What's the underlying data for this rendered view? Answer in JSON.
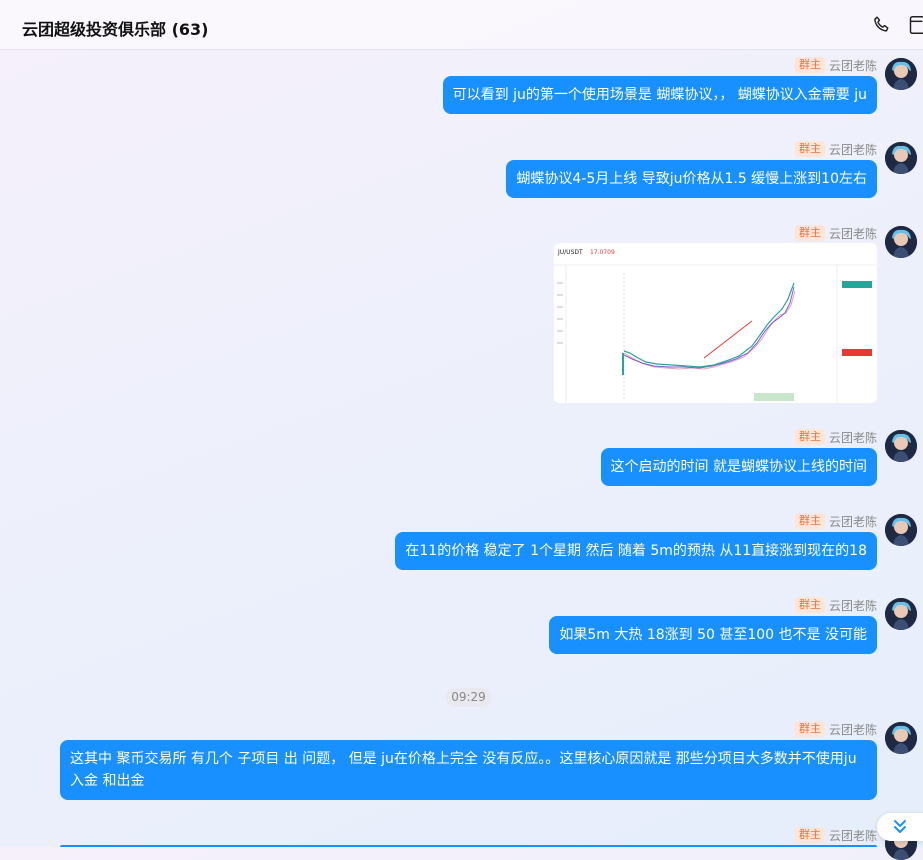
{
  "header": {
    "title": "云团超级投资俱乐部 (63)",
    "call_icon": "phone-icon",
    "more_icon": "window-icon"
  },
  "sender": {
    "badge": "群主",
    "name": "云团老陈"
  },
  "messages": [
    {
      "type": "text",
      "text": "可以看到 ju的第一个使用场景是 蝴蝶协议，， 蝴蝶协议入金需要 ju"
    },
    {
      "type": "text",
      "text": "蝴蝶协议4-5月上线 导致ju价格从1.5   缓慢上涨到10左右"
    },
    {
      "type": "image",
      "alt": "JU/USDT chart screenshot"
    },
    {
      "type": "text",
      "text": "这个启动的时间  就是蝴蝶协议上线的时间"
    },
    {
      "type": "text",
      "text": "在11的价格 稳定了 1个星期  然后 随着  5m的预热   从11直接涨到现在的18"
    },
    {
      "type": "text",
      "text": "如果5m 大热   18涨到  50  甚至100  也不是 没可能"
    },
    {
      "type": "text",
      "text": "这其中  聚币交易所 有几个 子项目 出 问题， 但是 ju在价格上完全 没有反应。。这里核心原因就是 那些分项目大多数并不使用ju入金 和出金"
    }
  ],
  "chart_thumb": {
    "pair": "JU/USDT",
    "price": "17.0709"
  },
  "time_divider": "09:29",
  "scroll_icon": "double-chevron-down-icon"
}
